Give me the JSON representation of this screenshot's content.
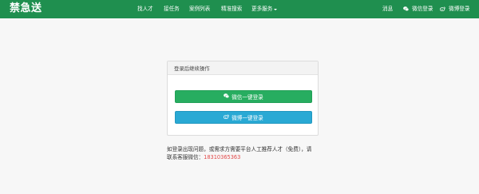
{
  "brand": {
    "logo_text": "禁急送"
  },
  "nav": {
    "items": [
      "找人才",
      "接任务",
      "案例列表",
      "精准搜索"
    ],
    "more_label": "更多服务"
  },
  "header_right": {
    "messages_label": "消息",
    "wechat_login_label": "微信登录",
    "weibo_login_label": "微博登录"
  },
  "panel": {
    "title": "登录后继续操作",
    "wechat_button_label": "微信一键登录",
    "weibo_button_label": "微博一键登录"
  },
  "note": {
    "text_line1": "如登录出现问题，或需求方需要平台人工推荐人才（免费），请",
    "text_line2_prefix": "联系客服微信：",
    "phone": "18310365363"
  },
  "colors": {
    "header_bg": "#1f8f4f",
    "wechat_button": "#27ad60",
    "weibo_button": "#29a9d4",
    "phone": "#e24b4b"
  },
  "icons": {
    "wechat": "wechat-icon",
    "weibo": "weibo-icon",
    "caret": "caret-down-icon"
  }
}
